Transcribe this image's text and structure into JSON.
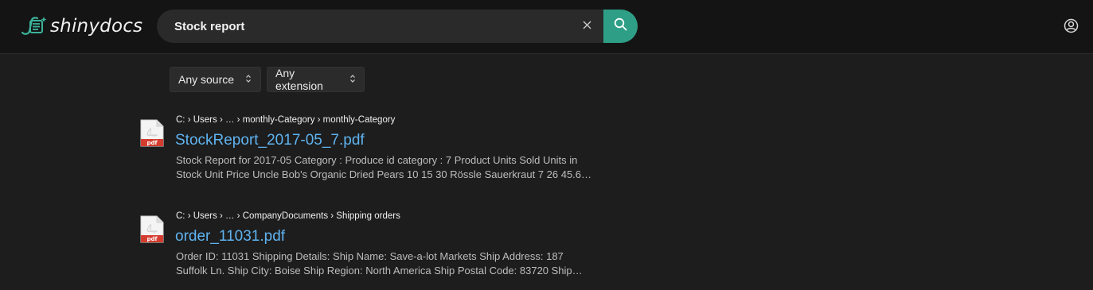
{
  "app": {
    "logo_text": "shinydocs",
    "brand_color": "#2e9f86",
    "link_color": "#5fb3f0"
  },
  "search": {
    "value": "Stock report",
    "clear_icon": "close-icon",
    "search_icon": "search-icon"
  },
  "header": {
    "account_icon": "user-circle-icon"
  },
  "filters": [
    {
      "label": "Any source",
      "icon": "chevron-up-down-icon"
    },
    {
      "label": "Any extension",
      "icon": "chevron-up-down-icon"
    }
  ],
  "results": [
    {
      "file_type": "pdf",
      "breadcrumb": "C: › Users › … › monthly-Category › monthly-Category",
      "title": "StockReport_2017-05_7.pdf",
      "snippet_line1": "Stock Report for 2017-05 Category : Produce id category : 7 Product Units Sold Units in",
      "snippet_line2": "Stock Unit Price Uncle Bob's Organic Dried Pears 10 15 30 Rössle Sauerkraut 7 26 45.6…"
    },
    {
      "file_type": "pdf",
      "breadcrumb": "C: › Users › … › CompanyDocuments › Shipping orders",
      "title": "order_11031.pdf",
      "snippet_line1": "Order ID: 11031 Shipping Details: Ship Name: Save-a-lot Markets Ship Address: 187",
      "snippet_line2": "Suffolk Ln. Ship City: Boise Ship Region: North America Ship Postal Code: 83720 Ship…"
    }
  ]
}
